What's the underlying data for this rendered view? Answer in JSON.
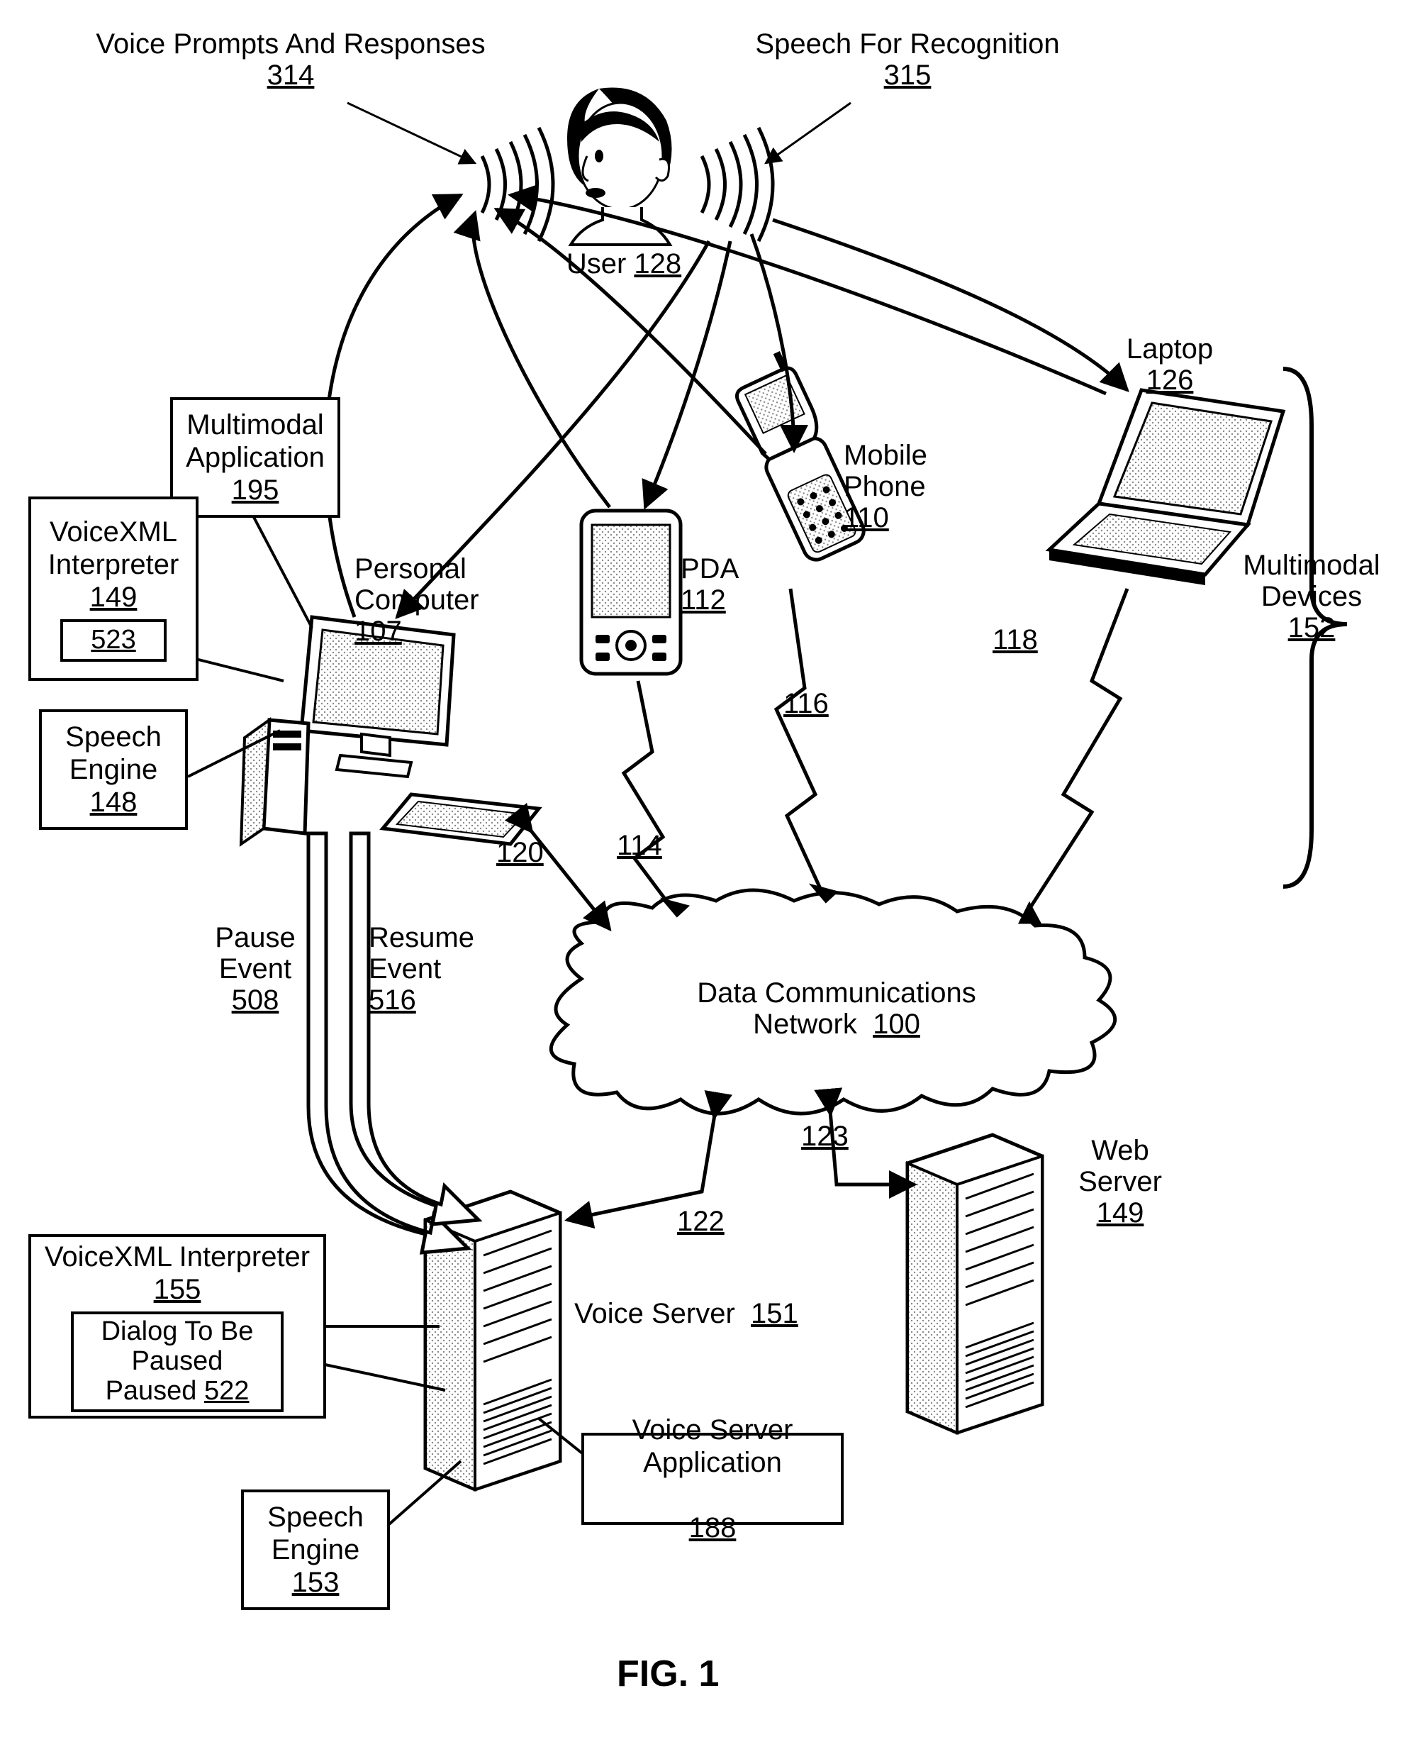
{
  "top_labels": {
    "voice_prompts": {
      "text": "Voice Prompts And Responses",
      "ref": "314"
    },
    "speech_rec": {
      "text": "Speech For Recognition",
      "ref": "315"
    },
    "user": {
      "text": "User",
      "ref": "128"
    }
  },
  "devices": {
    "laptop": {
      "text": "Laptop",
      "ref": "126"
    },
    "mobile": {
      "text": "Mobile Phone",
      "ref": "110"
    },
    "pda": {
      "text": "PDA",
      "ref": "112"
    },
    "pc": {
      "text": "Personal Computer",
      "ref": "107"
    }
  },
  "multimodal_devices": {
    "text": "Multimodal Devices",
    "ref": "152"
  },
  "pc_boxes": {
    "multimodal_app": {
      "text": "Multimodal Application",
      "ref": "195"
    },
    "voicexml_interp": {
      "text": "VoiceXML Interpreter",
      "ref": "149",
      "inner_ref": "523"
    },
    "speech_engine": {
      "text": "Speech Engine",
      "ref": "148"
    }
  },
  "link_refs": {
    "pc_net": "120",
    "pda_net": "114",
    "mobile_net": "116",
    "laptop_net": "118",
    "vs_net": "122",
    "ws_net": "123"
  },
  "events": {
    "pause": {
      "text": "Pause Event",
      "ref": "508"
    },
    "resume": {
      "text": "Resume Event",
      "ref": "516"
    }
  },
  "network": {
    "text": "Data Communications Network",
    "ref": "100"
  },
  "servers": {
    "voice_server": {
      "text": "Voice Server",
      "ref": "151"
    },
    "web_server": {
      "text": "Web Server",
      "ref": "149"
    }
  },
  "vs_boxes": {
    "voicexml_interp": {
      "text": "VoiceXML Interpreter",
      "ref": "155",
      "inner_text": "Dialog To Be Paused",
      "inner_ref": "522"
    },
    "speech_engine": {
      "text": "Speech Engine",
      "ref": "153"
    },
    "vs_app": {
      "text": "Voice Server Application",
      "ref": "188"
    }
  },
  "fig": "FIG. 1"
}
